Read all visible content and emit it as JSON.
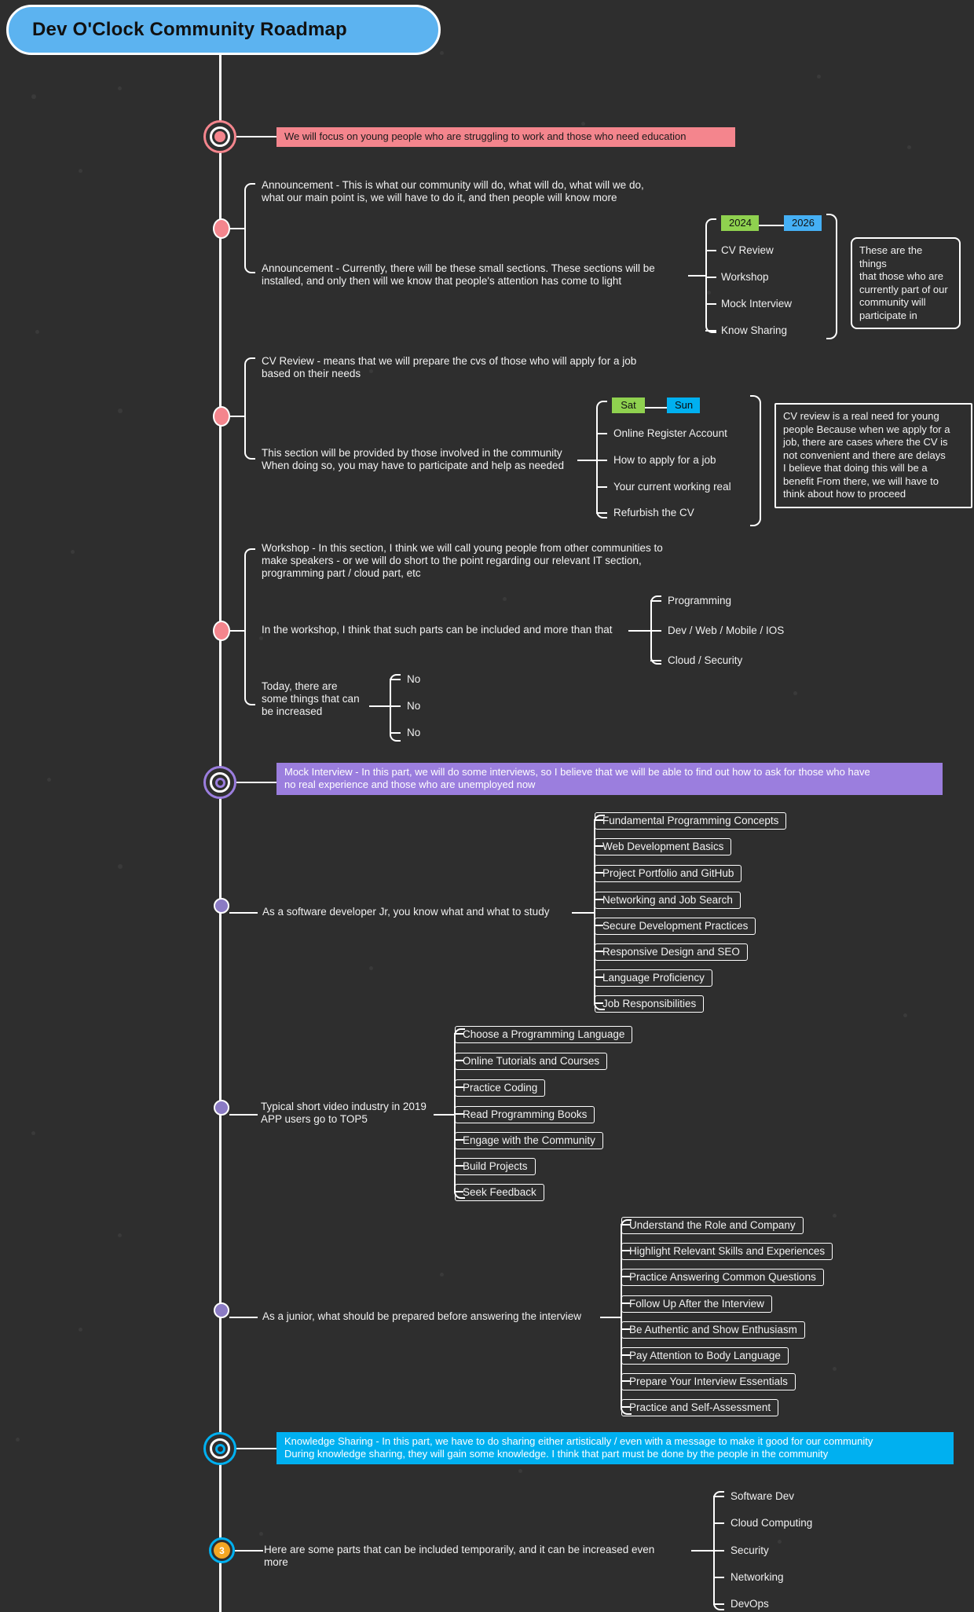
{
  "title": "Dev O'Clock Community Roadmap",
  "sections": {
    "focus_banner": "We will focus on young people who are struggling to work and those who need education",
    "announcement_1": "Announcement  - This is what our community will do, what will do, what will we do,\nwhat our main point is, we will have to do it, and then people will know more",
    "announcement_2": "Announcement - Currently, there will be these small sections. These sections will be\ninstalled, and only then will we know that people's attention has come to light",
    "year_tags": {
      "start": "2024",
      "end": "2026"
    },
    "section_list": [
      "CV Review",
      "Workshop",
      "Mock Interview",
      "Know Sharing"
    ],
    "section_callout": "These are the things\nthat those who are\ncurrently part of our\ncommunity will\nparticipate in",
    "cv_intro": "CV Review - means that we will prepare the cvs of those who will apply for a job\nbased on their needs",
    "cv_provided": "This section will be provided by those involved in the community\nWhen doing so, you may have to participate and help as needed",
    "day_tags": {
      "start": "Sat",
      "end": "Sun"
    },
    "cv_list": [
      "Online Register Account",
      "How to apply for a job",
      "Your current working real",
      "Refurbish the CV"
    ],
    "cv_callout": "CV review is a real need for young\npeople Because when we apply for a\njob, there are cases where the CV is\nnot convenient and there are delays\nI believe that doing this will be a\nbenefit From there, we will have to\nthink about how to proceed",
    "workshop_intro": "Workshop - In this section, I think we will call young people from other communities to\nmake speakers - or we will do short to the point regarding our relevant IT section,\nprogramming part / cloud part, etc",
    "workshop_parts_label": "In the workshop, I think that such parts can be included and more than that",
    "workshop_parts": [
      "Programming",
      "Dev / Web / Mobile / IOS",
      "Cloud / Security"
    ],
    "today_label": "Today, there are\nsome things that can\nbe increased",
    "today_items": [
      "No",
      "No",
      "No"
    ],
    "mock_banner": "Mock Interview - In this part, we will do some interviews, so I believe that we will be able to find out how to ask for those who have\nno real experience and those who are unemployed now",
    "jr_label": "As a software developer Jr, you know what and what to study",
    "jr_items": [
      "Fundamental Programming Concepts",
      "Web Development Basics",
      "Project Portfolio and GitHub",
      "Networking and Job Search",
      "Secure Development Practices",
      "Responsive Design and SEO",
      "Language Proficiency",
      "Job Responsibilities"
    ],
    "video_label": "Typical short video industry in 2019\nAPP users go to TOP5",
    "video_items": [
      "Choose a Programming Language",
      "Online Tutorials and Courses",
      "Practice Coding",
      "Read Programming Books",
      "Engage with the Community",
      "Build Projects",
      "Seek Feedback"
    ],
    "junior_label": "As a junior, what should be prepared before answering the interview",
    "junior_items": [
      "Understand the Role and Company",
      "Highlight Relevant Skills and Experiences",
      "Practice Answering Common Questions",
      "Follow Up After the Interview",
      "Be Authentic and Show Enthusiasm",
      "Pay Attention to Body Language",
      "Prepare Your Interview Essentials",
      "Practice and Self-Assessment"
    ],
    "knowledge_banner": "Knowledge Sharing - In this part, we have to do sharing either artistically / even with a message to make it good for our community\n During knowledge sharing, they will gain some knowledge. I think that part must be done by the people in the community",
    "final_node_number": "3",
    "final_label": "Here are some parts that can be included temporarily, and it can be increased even\nmore",
    "final_items": [
      "Software Dev",
      "Cloud Computing",
      "Security",
      "Networking",
      "DevOps"
    ]
  },
  "colors": {
    "background": "#2e2e2e",
    "title_fill": "#5cb3f0",
    "banner_red": "#f4858d",
    "banner_purple": "#9b7ede",
    "banner_cyan": "#00b0f0",
    "chip_green": "#8fd14f",
    "chip_blue": "#45b0f5",
    "node_red": "#f4858d",
    "node_purple": "#9b7ede",
    "node_cyan": "#00b0f0",
    "node_orange": "#f5a623"
  }
}
